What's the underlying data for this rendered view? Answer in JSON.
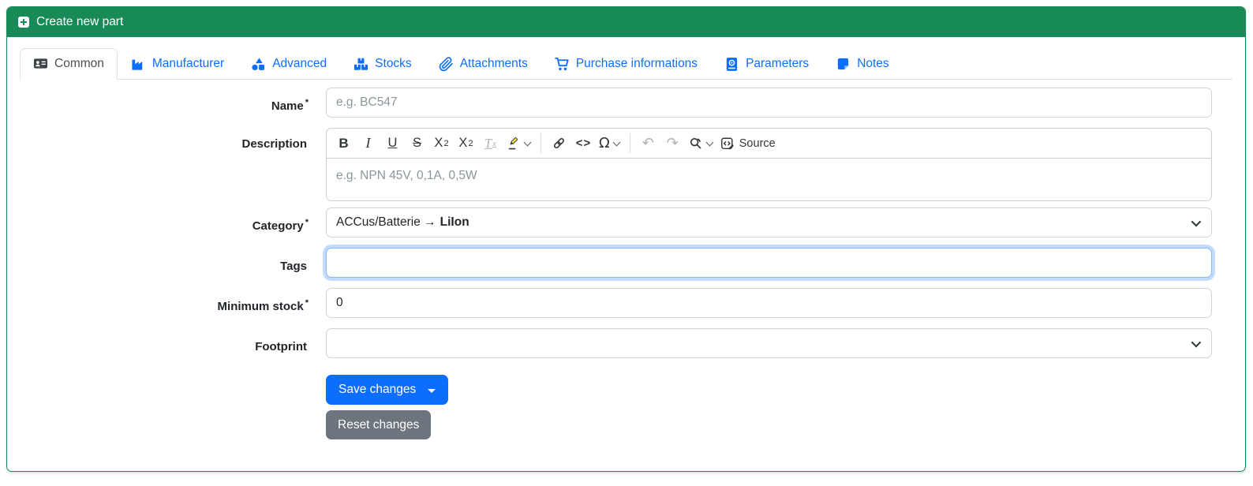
{
  "header": {
    "title": "Create new part"
  },
  "tabs": [
    {
      "label": "Common",
      "active": true
    },
    {
      "label": "Manufacturer",
      "active": false
    },
    {
      "label": "Advanced",
      "active": false
    },
    {
      "label": "Stocks",
      "active": false
    },
    {
      "label": "Attachments",
      "active": false
    },
    {
      "label": "Purchase informations",
      "active": false
    },
    {
      "label": "Parameters",
      "active": false
    },
    {
      "label": "Notes",
      "active": false
    }
  ],
  "form": {
    "name": {
      "label": "Name",
      "required_marker": "*",
      "placeholder": "e.g. BC547",
      "value": ""
    },
    "description": {
      "label": "Description",
      "required_marker": "",
      "placeholder": "e.g. NPN 45V, 0,1A, 0,5W",
      "value": ""
    },
    "category": {
      "label": "Category",
      "required_marker": "*",
      "value_prefix": "ACCus/Batterie →",
      "value_bold": "LiIon"
    },
    "tags": {
      "label": "Tags",
      "required_marker": "",
      "value": "",
      "placeholder": ""
    },
    "minimum_stock": {
      "label": "Minimum stock",
      "required_marker": "*",
      "value": "0"
    },
    "footprint": {
      "label": "Footprint",
      "required_marker": "",
      "value": ""
    }
  },
  "editor_toolbar": {
    "bold": "B",
    "italic": "I",
    "underline": "U",
    "strikethrough": "S",
    "subscript_base": "X",
    "subscript_mark": "2",
    "superscript_base": "X",
    "superscript_mark": "2",
    "remove_format_base": "T",
    "remove_format_mark": "x",
    "code": "<>",
    "special_characters": "Ω",
    "undo": "↶",
    "redo": "↷",
    "source_label": "Source"
  },
  "actions": {
    "save_label": "Save changes",
    "reset_label": "Reset changes"
  },
  "colors": {
    "header_green": "#188a58",
    "tab_link_blue": "#0d6efd",
    "primary_button_blue": "#0d6efd",
    "secondary_button_gray": "#6c757d",
    "focus_border_blue": "#86b7fe",
    "input_border_gray": "#ced4da"
  }
}
